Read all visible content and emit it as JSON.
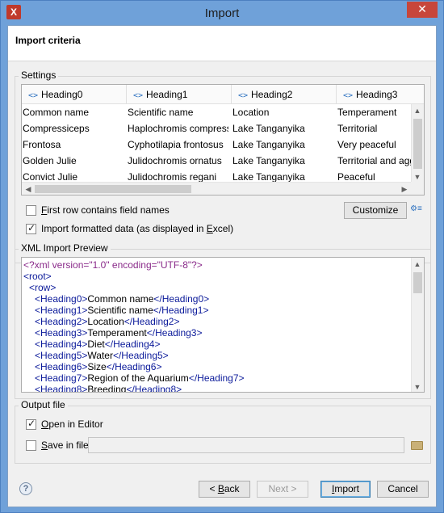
{
  "window": {
    "title": "Import",
    "close_glyph": "✕",
    "app_icon_glyph": "X"
  },
  "header": {
    "title": "Import criteria"
  },
  "settings": {
    "group_label": "Settings",
    "columns": [
      "Heading0",
      "Heading1",
      "Heading2",
      "Heading3"
    ],
    "rows": [
      [
        "Common name",
        "Scientific name",
        "Location",
        "Temperament"
      ],
      [
        "Compressiceps",
        "Haplochromis compressi...",
        "Lake Tanganyika",
        "Territorial"
      ],
      [
        "Frontosa",
        "Cyphotilapia frontosus",
        "Lake Tanganyika",
        "Very peaceful"
      ],
      [
        "Golden Julie",
        "Julidochromis ornatus",
        "Lake Tanganyika",
        "Territorial and aggr"
      ],
      [
        "Convict Julie",
        "Julidochromis regani",
        "Lake Tanganyika",
        "Peaceful"
      ]
    ],
    "first_row_label_pre": "F",
    "first_row_label_rest": "irst row contains field names",
    "first_row_checked": false,
    "formatted_label": "Import formatted data (as displayed in ",
    "formatted_label_ul": "E",
    "formatted_label_end": "xcel)",
    "formatted_checked": true,
    "customize_label": "Customize"
  },
  "xml_preview": {
    "group_label": "XML Import Preview",
    "lines": [
      {
        "indent": 0,
        "parts": [
          {
            "c": "purple",
            "t": "<?xml version=\"1.0\" encoding=\"UTF-8\"?>"
          }
        ]
      },
      {
        "indent": 0,
        "parts": [
          {
            "c": "blue",
            "t": "<root>"
          }
        ]
      },
      {
        "indent": 1,
        "parts": [
          {
            "c": "blue",
            "t": "<row>"
          }
        ]
      },
      {
        "indent": 2,
        "parts": [
          {
            "c": "blue",
            "t": "<Heading0>"
          },
          {
            "c": "black",
            "t": "Common name"
          },
          {
            "c": "blue",
            "t": "</Heading0>"
          }
        ]
      },
      {
        "indent": 2,
        "parts": [
          {
            "c": "blue",
            "t": "<Heading1>"
          },
          {
            "c": "black",
            "t": "Scientific name"
          },
          {
            "c": "blue",
            "t": "</Heading1>"
          }
        ]
      },
      {
        "indent": 2,
        "parts": [
          {
            "c": "blue",
            "t": "<Heading2>"
          },
          {
            "c": "black",
            "t": "Location"
          },
          {
            "c": "blue",
            "t": "</Heading2>"
          }
        ]
      },
      {
        "indent": 2,
        "parts": [
          {
            "c": "blue",
            "t": "<Heading3>"
          },
          {
            "c": "black",
            "t": "Temperament"
          },
          {
            "c": "blue",
            "t": "</Heading3>"
          }
        ]
      },
      {
        "indent": 2,
        "parts": [
          {
            "c": "blue",
            "t": "<Heading4>"
          },
          {
            "c": "black",
            "t": "Diet"
          },
          {
            "c": "blue",
            "t": "</Heading4>"
          }
        ]
      },
      {
        "indent": 2,
        "parts": [
          {
            "c": "blue",
            "t": "<Heading5>"
          },
          {
            "c": "black",
            "t": "Water"
          },
          {
            "c": "blue",
            "t": "</Heading5>"
          }
        ]
      },
      {
        "indent": 2,
        "parts": [
          {
            "c": "blue",
            "t": "<Heading6>"
          },
          {
            "c": "black",
            "t": "Size"
          },
          {
            "c": "blue",
            "t": "</Heading6>"
          }
        ]
      },
      {
        "indent": 2,
        "parts": [
          {
            "c": "blue",
            "t": "<Heading7>"
          },
          {
            "c": "black",
            "t": "Region of the Aquarium"
          },
          {
            "c": "blue",
            "t": "</Heading7>"
          }
        ]
      },
      {
        "indent": 2,
        "parts": [
          {
            "c": "blue",
            "t": "<Heading8>"
          },
          {
            "c": "black",
            "t": "Breeding"
          },
          {
            "c": "blue",
            "t": "</Heading8>"
          }
        ]
      }
    ]
  },
  "output": {
    "group_label": "Output file",
    "open_label_ul": "O",
    "open_label_rest": "pen in Editor",
    "open_checked": true,
    "save_label_ul": "S",
    "save_label_rest": "ave in file",
    "save_checked": false,
    "save_path": ""
  },
  "footer": {
    "help_glyph": "?",
    "back_label_pre": "< ",
    "back_label_ul": "B",
    "back_label_rest": "ack",
    "next_label": "Next >",
    "import_label_ul": "I",
    "import_label_rest": "mport",
    "cancel_label": "Cancel"
  }
}
